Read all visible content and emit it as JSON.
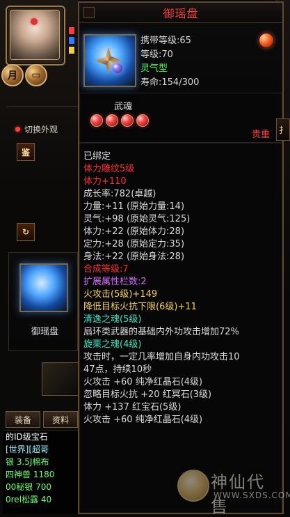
{
  "tooltip": {
    "title": "御瑶盘",
    "item": {
      "carry_level": "携带等级:65",
      "level": "等级:70",
      "type": "灵气型",
      "life": "寿命:154/300"
    },
    "wuhun_label": "武魂",
    "rarity": "贵重",
    "lines": [
      {
        "text": "已绑定",
        "cls": "gray"
      },
      {
        "text": "体力雕纹5级",
        "cls": "red"
      },
      {
        "text": "体力+110",
        "cls": "red"
      },
      {
        "text": "成长率:782(卓越)",
        "cls": "gray"
      },
      {
        "text": "力量:+11 (原始力量:14)",
        "cls": "gray"
      },
      {
        "text": "灵气:+98 (原始灵气:125)",
        "cls": "gray"
      },
      {
        "text": "体力:+22 (原始体力:28)",
        "cls": "gray"
      },
      {
        "text": "定力:+28 (原始定力:35)",
        "cls": "gray"
      },
      {
        "text": "身法:+22 (原始身法:28)",
        "cls": "gray"
      },
      {
        "text": "合成等级:7",
        "cls": "red"
      },
      {
        "text": "扩展属性栏数:2",
        "cls": "purple"
      },
      {
        "text": "火攻击(5级)+149",
        "cls": "yellow"
      },
      {
        "text": "降低目标火抗下限(6级)+11",
        "cls": "yellow"
      },
      {
        "text": "清逸之魂(5级)",
        "cls": "teal"
      },
      {
        "text": "扇环类武器的基础内外功攻击增加72%",
        "cls": "gray"
      },
      {
        "text": "旋栗之魂(4级)",
        "cls": "teal"
      },
      {
        "text": "攻击时，一定几率增加自身内功攻击10",
        "cls": "gray"
      },
      {
        "text": "47点，持续10秒",
        "cls": "gray"
      },
      {
        "text": "火攻击 +60 纯净红晶石(4级)",
        "cls": "gray"
      },
      {
        "text": "忽略目标火抗 +20 红冥石(3级)",
        "cls": "gray"
      },
      {
        "text": "体力 +137 红宝石(5级)",
        "cls": "gray"
      },
      {
        "text": "火攻击 +60 纯净红晶石(4级)",
        "cls": "gray"
      }
    ]
  },
  "left": {
    "switch_label": "切换外观",
    "appraise": "鉴",
    "side_item_name": "御瑶盘",
    "tabs": [
      "装备",
      "资料"
    ],
    "chat": [
      "的ID级宝石",
      "[世界][超哥",
      "银 3.5J棉布",
      "四神兽 1180",
      "00秘银 700",
      "0rel松露 40"
    ]
  },
  "watermark": {
    "text": "神仙代售",
    "url": "WWW.SXDS.COM"
  },
  "right_tabs": [
    "扌"
  ]
}
